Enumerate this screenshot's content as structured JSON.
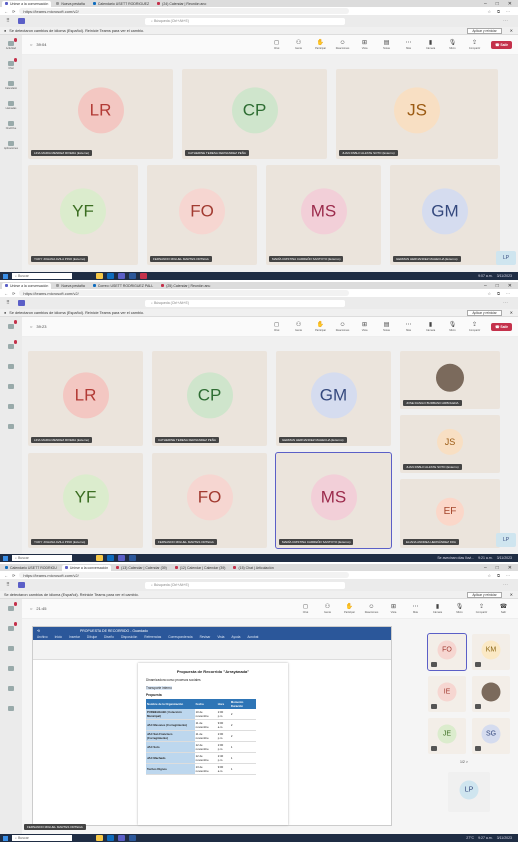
{
  "shot1": {
    "tabs": [
      {
        "label": "Unirse a la conversación"
      },
      {
        "label": "Nueva pestaña"
      },
      {
        "label": "Calendario USETT RODRIGUEZ"
      },
      {
        "label": "(24) Calendar | Reunión ano"
      }
    ],
    "url": "https://teams.microsoft.com/v2/",
    "search": "Búsqueda (Ctrl+Alt+E)",
    "notice": "Se detectaron cambios de idioma (Español). Reinicie Teams para ver el cambio.",
    "apply": "Aplicar y reiniciar",
    "timer": "39:04",
    "controls": [
      "Chat",
      "Gente",
      "Participar",
      "Reacciones",
      "Vista",
      "Notas",
      "Más",
      "Cámara",
      "Micro",
      "Compartir"
    ],
    "leave": "Salir",
    "tooltip": "Restablecer audio del micrófono (Ctrl+Shift+M)",
    "tiles": [
      {
        "initials": "LR",
        "name": "LINA MARIA MENDEZ RIVERA (Externo)",
        "color": "#f3c7c2",
        "text": "#b23a35"
      },
      {
        "initials": "CP",
        "name": "CATHERINE TERESA FERNANDEZ PEÑA",
        "color": "#cfe5cc",
        "text": "#2e6d33"
      },
      {
        "initials": "JS",
        "name": "JUAN PABLO ALZATE SOTO (Externo)",
        "color": "#f8dfc3",
        "text": "#9b5a12"
      },
      {
        "initials": "YF",
        "name": "YUDY JOHANA AVILA PINO (Externo)",
        "color": "#dbeccd",
        "text": "#3b6e22"
      },
      {
        "initials": "FO",
        "name": "FERNANDO MIGUEL MARTES ORTEGA",
        "color": "#f6d6d1",
        "text": "#a23b31"
      },
      {
        "initials": "MS",
        "name": "MARÍA CRISTINA CARREÑO SANTOYO (Externo)",
        "color": "#f2cfd8",
        "text": "#9b2a4b"
      },
      {
        "initials": "GM",
        "name": "GERMAN HERNANDEZ MAHECHA (Externo)",
        "color": "#d5dcef",
        "text": "#35497e"
      }
    ],
    "self": "LP",
    "rail": [
      "Actividad",
      "Chat",
      "Calendario",
      "Llamadas",
      "OneDrive",
      "Aplicaciones"
    ],
    "taskbar": {
      "search": "Buscar",
      "time": "9:07 a.m.",
      "date": "3/11/2023"
    }
  },
  "shot2": {
    "tabs": [
      {
        "label": "Unirse a la conversación"
      },
      {
        "label": "Nueva pestaña"
      },
      {
        "label": "Correo: USETT RODRIGUEZ PALL"
      },
      {
        "label": "(25) Calendar | Reunión anu"
      }
    ],
    "url": "https://teams.microsoft.com/v2/",
    "search": "Búsqueda (Ctrl+Alt+E)",
    "notice": "Se detectaron cambios de idioma (Español). Reinicie Teams para ver el cambio.",
    "apply": "Aplicar y reiniciar",
    "timer": "39:23",
    "leave": "Salir",
    "tiles": [
      {
        "initials": "LR",
        "name": "LINA MARIA MENDEZ RIVERA (Externo)",
        "color": "#f3c7c2",
        "text": "#b23a35"
      },
      {
        "initials": "CP",
        "name": "CATHERINE TERESA FERNANDEZ PEÑA",
        "color": "#cfe5cc",
        "text": "#2e6d33"
      },
      {
        "initials": "GM",
        "name": "GERMAN HERNANDEZ MAHECHA (Externo)",
        "color": "#d5dcef",
        "text": "#35497e"
      },
      {
        "initials": "",
        "name": "JOSE DANILO BURBANO ARBOLEDA",
        "color": "#7b6a5c",
        "text": "#fff"
      },
      {
        "initials": "JS",
        "name": "JUAN PABLO ALZATE SOTO (Externo)",
        "color": "#f8dfc3",
        "text": "#9b5a12"
      },
      {
        "initials": "YF",
        "name": "YUDY JOHANA AVILA PINO (Externo)",
        "color": "#dbeccd",
        "text": "#3b6e22"
      },
      {
        "initials": "FO",
        "name": "FERNANDO MIGUEL MARTES ORTEGA",
        "color": "#f6d6d1",
        "text": "#a23b31"
      },
      {
        "initials": "MS",
        "name": "MARÍA CRISTINA CARREÑO SANTOYO (Externo)",
        "color": "#f2cfd8",
        "text": "#9b2a4b"
      },
      {
        "initials": "EF",
        "name": "ELIANA ANDREA HERNÁNDEZ FRA",
        "color": "#fbd7c9",
        "text": "#a4442a"
      }
    ],
    "self": "LP",
    "taskbar": {
      "search": "Buscar",
      "notif": "Se avecinan días lluvi...",
      "time": "9:21 a.m.",
      "date": "3/11/2023"
    }
  },
  "shot3": {
    "tabs": [
      {
        "label": "Calendario USETT RODRIGU"
      },
      {
        "label": "Unirse a la conversación"
      },
      {
        "label": "(13) Calendar | Calendar (39)"
      },
      {
        "label": "(12) Calendar | Calendar (39)"
      },
      {
        "label": "(15) Chat | Articulación"
      }
    ],
    "url": "https://teams.microsoft.com/v2/",
    "search": "Búsqueda (Ctrl+Alt+E)",
    "notice": "Se detectaron cambios de idioma (Español). Reinicie Teams para ver el cambio.",
    "apply": "Aplicar y reiniciar",
    "timer": "21:45",
    "leave": "Salir",
    "doc": {
      "title": "PROPUESTA DE RECORRIDO - Guardado",
      "menu": [
        "Archivo",
        "Inicio",
        "Insertar",
        "Dibujar",
        "Diseño",
        "Disposición",
        "Referencias",
        "Correspondencia",
        "Revisar",
        "Vista",
        "Ayuda",
        "Acrobat"
      ],
      "heading": "Propuesta de Recorrido \"Arrayánada\"",
      "p1": "Dinamizadora curso procesos sociales",
      "p2": "Transporte interno",
      "p3": "Propuesta",
      "cols": [
        "Nombre de la Organización",
        "Fecha",
        "Hora",
        "Momento Duración"
      ],
      "rows": [
        [
          "PURBEHGABI ( Colección Municipal)",
          "10 de noviembre",
          "2:00 p.m.",
          "2"
        ],
        [
          "JAC Mesones (Corregimiento)",
          "11 de noviembre",
          "9:00 a.m.",
          "2"
        ],
        [
          "JAC San Francisco (Corregimiento)",
          "11 de noviembre",
          "2:00 p.m.",
          "2"
        ],
        [
          "JAC Soto",
          "12 de noviembre",
          "2:00 p.m.",
          "1"
        ],
        [
          "JAC Machado",
          "12 de noviembre",
          "2:40 p.m.",
          "1"
        ],
        [
          "Techos Dignos",
          "13 de noviembre",
          "9:00 a.m.",
          "1"
        ]
      ]
    },
    "presenter": "FERNANDO MIGUEL MARTES ORTEGA",
    "side": [
      {
        "initials": "FO",
        "color": "#f6d6d1",
        "text": "#a23b31"
      },
      {
        "initials": "KM",
        "color": "#fbe9c5",
        "text": "#8a6513"
      },
      {
        "initials": "IE",
        "color": "#f6d6d1",
        "text": "#a23b31"
      },
      {
        "initials": "",
        "color": "#7b6a5c",
        "text": "#fff"
      },
      {
        "initials": "JE",
        "color": "#dbeccd",
        "text": "#3b6e22"
      },
      {
        "initials": "SG",
        "color": "#d5dcef",
        "text": "#35497e"
      }
    ],
    "pager": "1/2 >",
    "self": "LP",
    "taskbar": {
      "search": "Buscar",
      "weather": "27°C",
      "time": "9:27 a.m.",
      "date": "3/11/2023"
    }
  }
}
